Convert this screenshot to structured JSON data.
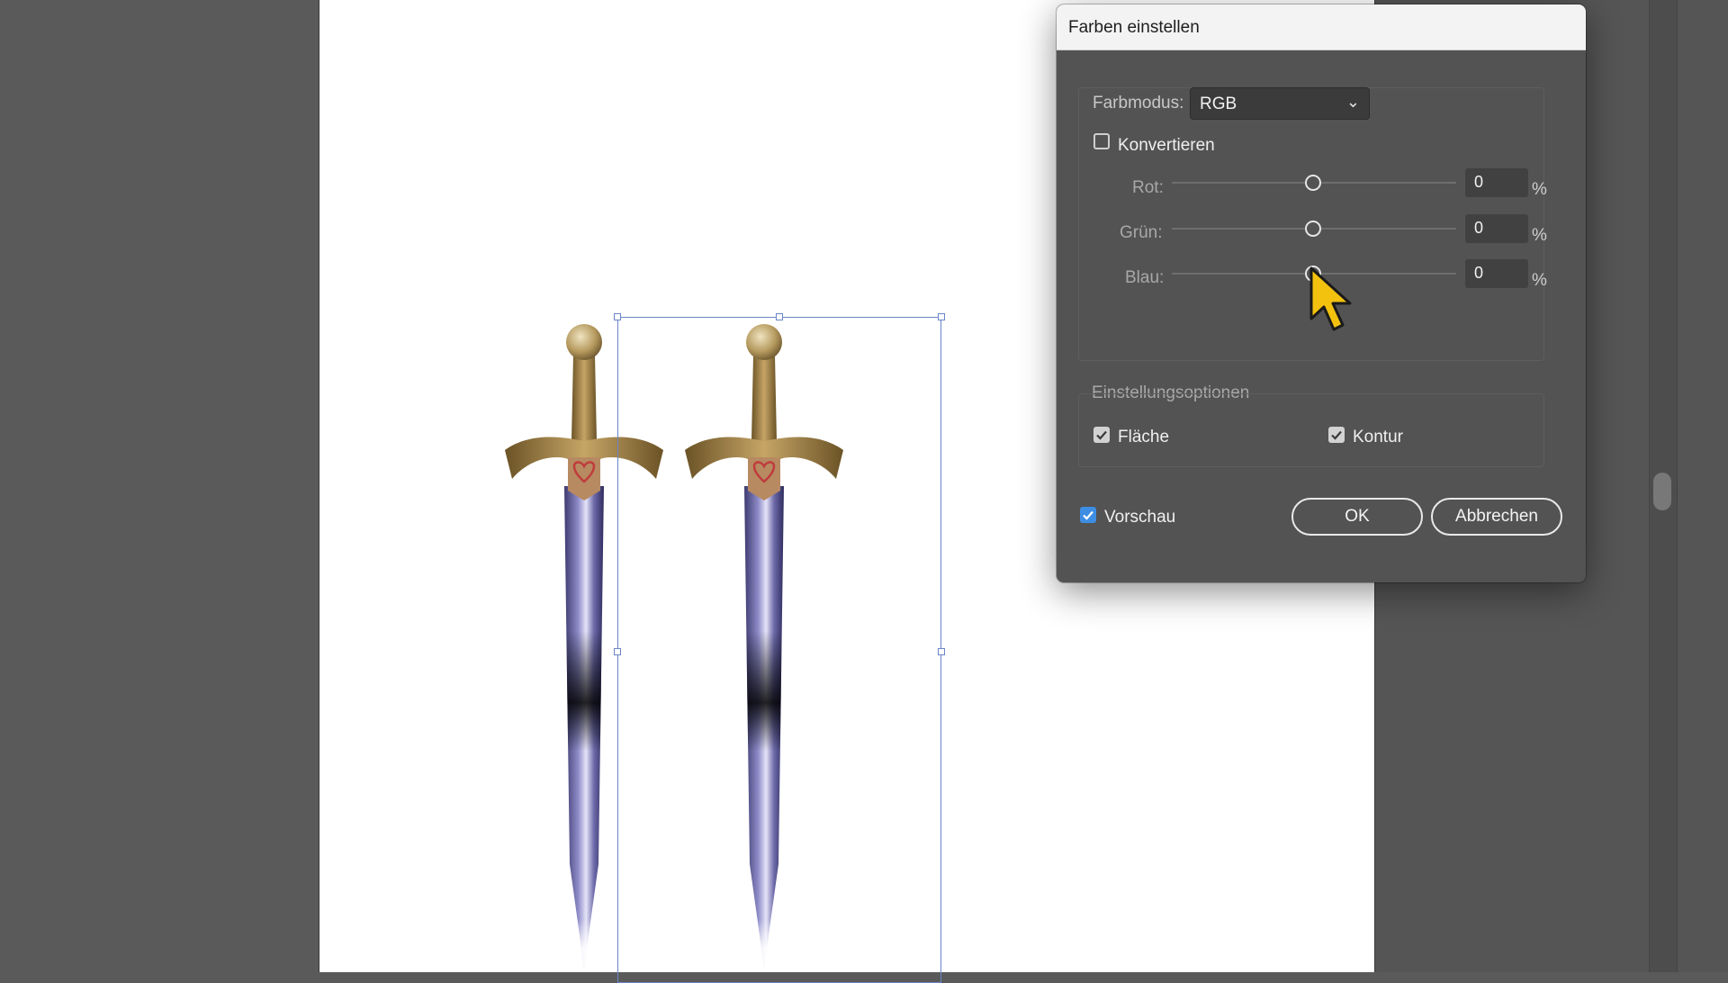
{
  "dialog": {
    "title": "Farben einstellen",
    "color_mode_label": "Farbmodus:",
    "color_mode_value": "RGB",
    "convert_label": "Konvertieren",
    "convert_checked": false,
    "channels": [
      {
        "label": "Rot:",
        "value": "0",
        "unit": "%"
      },
      {
        "label": "Grün:",
        "value": "0",
        "unit": "%"
      },
      {
        "label": "Blau:",
        "value": "0",
        "unit": "%"
      }
    ],
    "options_heading": "Einstellungsoptionen",
    "fill_label": "Fläche",
    "fill_checked": true,
    "stroke_label": "Kontur",
    "stroke_checked": true,
    "preview_label": "Vorschau",
    "preview_checked": true,
    "ok_label": "OK",
    "cancel_label": "Abbrechen"
  },
  "colors": {
    "accent_blue": "#3d8ee3",
    "selection": "#6a86c8",
    "dialog_bg": "#535353",
    "cursor_yellow": "#f2c20f"
  },
  "canvas": {
    "objects": [
      "sword-left",
      "sword-right"
    ],
    "selected": "sword-right"
  }
}
